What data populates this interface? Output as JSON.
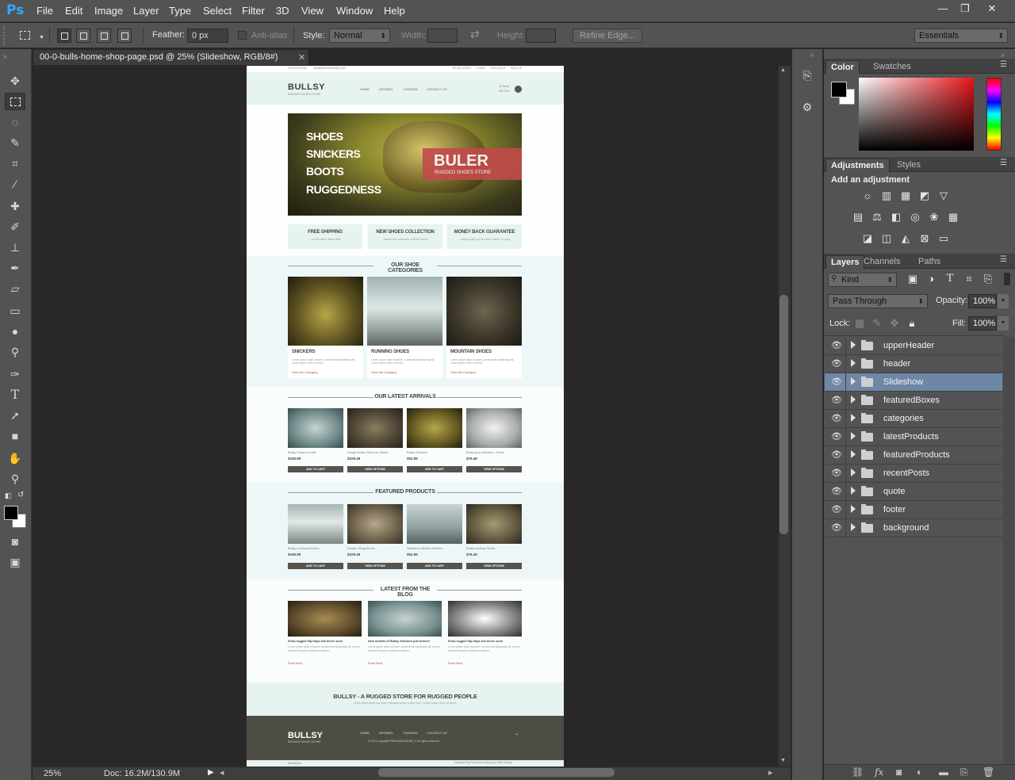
{
  "app": {
    "logo": "Ps"
  },
  "menu": [
    "File",
    "Edit",
    "Image",
    "Layer",
    "Type",
    "Select",
    "Filter",
    "3D",
    "View",
    "Window",
    "Help"
  ],
  "window_controls": {
    "minimize": "—",
    "restore": "❐",
    "close": "✕"
  },
  "options": {
    "feather_label": "Feather:",
    "feather_value": "0 px",
    "antialias_label": "Anti-alias",
    "style_label": "Style:",
    "style_value": "Normal",
    "width_label": "Width:",
    "height_label": "Height:",
    "refine_edge": "Refine Edge...",
    "workspace": "Essentials"
  },
  "document": {
    "tab_title": "00-0-bulls-home-shop-page.psd @ 25% (Slideshow, RGB/8#)",
    "close": "✕",
    "zoom": "25%",
    "doc_size": "Doc: 16.2M/130.9M"
  },
  "panels": {
    "color_tabs": [
      "Color",
      "Swatches"
    ],
    "adjust_tabs": [
      "Adjustments",
      "Styles"
    ],
    "add_adjustment": "Add an adjustment",
    "layer_tabs": [
      "Layers",
      "Channels",
      "Paths"
    ],
    "kind": "Kind",
    "blend_mode": "Pass Through",
    "opacity_label": "Opacity:",
    "opacity": "100%",
    "lock_label": "Lock:",
    "fill_label": "Fill:",
    "fill": "100%",
    "layers": [
      {
        "name": "upperHeader",
        "selected": false
      },
      {
        "name": "header",
        "selected": false
      },
      {
        "name": "Slideshow",
        "selected": true
      },
      {
        "name": "featuredBoxes",
        "selected": false
      },
      {
        "name": "categories",
        "selected": false
      },
      {
        "name": "latestProducts",
        "selected": false
      },
      {
        "name": "featuredProducts",
        "selected": false
      },
      {
        "name": "recentPosts",
        "selected": false
      },
      {
        "name": "quote",
        "selected": false
      },
      {
        "name": "footer",
        "selected": false
      },
      {
        "name": "background",
        "selected": false
      }
    ]
  },
  "mock": {
    "upper_left": "(+000) 675 456",
    "upper_email": "info@premiumcoding.com",
    "upper_right": [
      "MY ACCOUNT",
      "LOGIN",
      "CHECKOUT",
      "SIGN UP"
    ],
    "logo": "BULLSY",
    "logo_sub": "RUGGED SHOES STORE",
    "nav": [
      "HOME",
      "APPAREL",
      "FASHION",
      "CONTACT US"
    ],
    "cart_items": "25 Items",
    "cart_total": "459.90 €",
    "slide_words": [
      "SHOES",
      "SNICKERS",
      "BOOTS",
      "RUGGEDNESS"
    ],
    "slide_brand": "BULER",
    "slide_brand_sub": "RUGGED SHOES STORE",
    "boxes": [
      {
        "title": "FREE SHIPPING",
        "text": "- on all orders above $99"
      },
      {
        "title": "NEW SHOES COLLECTION",
        "text": "- brand new collection of Bulls Shoes"
      },
      {
        "title": "MONEY BACK GUARANTEE",
        "text": "- return policy on all orders within 14 days"
      }
    ],
    "categories_title": "OUR SHOE CATEGORIES",
    "categories": [
      {
        "name": "SNICKERS",
        "link": "View the Category"
      },
      {
        "name": "RUNNING SHOES",
        "link": "View the Category"
      },
      {
        "name": "MOUNTAIN SHOES",
        "link": "View the Category"
      }
    ],
    "cat_desc": "Lorem ipsum dolor sit amet, consectetur adipiscing elit. Lorem ipsum dolor sit amet.",
    "latest_title": "OUR LATEST ARRIVALS",
    "latest": [
      {
        "name": "Bullsy Shoes in white",
        "price": "$159.99",
        "btn": "ADD TO CART"
      },
      {
        "name": "Rough Bullsy Shoes for Winter",
        "price": "$329.49",
        "btn": "VIEW OPTIONS"
      },
      {
        "name": "Bullsy Snickers",
        "price": "$52.99",
        "btn": "ADD TO CART"
      },
      {
        "name": "Bullsy grey Snickers / Shoes",
        "price": "$79.49",
        "btn": "VIEW OPTIONS"
      }
    ],
    "featured_title": "FEATURED PRODUCTS",
    "featured": [
      {
        "name": "Bullsy running Snickers",
        "price": "$159.99",
        "btn": "ADD TO CART"
      },
      {
        "name": "Rough Hiking Shoes",
        "price": "$329.49",
        "btn": "VIEW OPTIONS"
      },
      {
        "name": "Waterproof Bullsy Snickers",
        "price": "$52.99",
        "btn": "ADD TO CART"
      },
      {
        "name": "Bullsy working Shoes",
        "price": "$79.49",
        "btn": "VIEW OPTIONS"
      }
    ],
    "blog_title": "LATEST FROM THE BLOG",
    "blog": [
      {
        "title": "Extra rugged flip-flops will arrive soon",
        "more": "Read More"
      },
      {
        "title": "New models of Bullsy Snickers just arrived",
        "more": "Read More"
      },
      {
        "title": "Extra rugged flip-flops will arrive soon",
        "more": "Read More"
      }
    ],
    "blog_text": "Lorem ipsum dolor sit amet, consectetur adipiscing elit, sed do eiusmod tempor incididunt ut labore.",
    "quote_title": "BULLSY - A RUGGED STORE FOR RUGGED PEOPLE",
    "quote_text": "Learn more about our store regulations and policy here. Lorem ipsum dolor sit amet.",
    "footer_copy": "© 2013 copyright PREMIUMCODING // All rights reserved",
    "footer_credit": "Designed by PremiumCoding.com Web Design"
  },
  "colors": {
    "accent": "#31a8ff",
    "selected_layer": "#6f87a6",
    "slide_red": "#c24a4a",
    "mint": "#e6f3ee"
  }
}
